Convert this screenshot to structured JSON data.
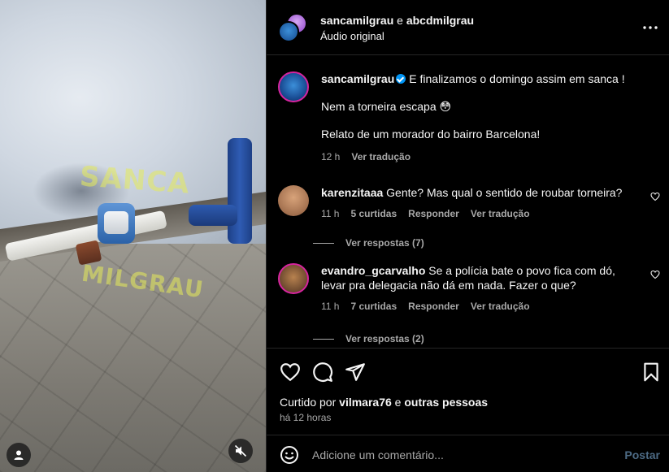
{
  "media": {
    "watermark_top": "SANCA",
    "watermark_bottom": "MILGRAU"
  },
  "header": {
    "user1": "sancamilgrau",
    "conj": "e",
    "user2": "abcdmilgrau",
    "audio": "Áudio original"
  },
  "caption": {
    "username": "sancamilgrau",
    "line1": "E finalizamos o domingo assim em sanca !",
    "line2": "Nem a torneira escapa 😳",
    "line3": "Relato de um morador do bairro Barcelona!",
    "time": "12 h",
    "translate": "Ver tradução"
  },
  "comments": [
    {
      "username": "karenzitaaa",
      "text": "Gente? Mas qual o sentido de roubar torneira?",
      "time": "11 h",
      "likes": "5 curtidas",
      "reply": "Responder",
      "translate": "Ver tradução",
      "replies": "Ver respostas (7)"
    },
    {
      "username": "evandro_gcarvalho",
      "text": "Se a polícia bate o povo fica com dó, levar pra delegacia não dá em nada. Fazer o que?",
      "time": "11 h",
      "likes": "7 curtidas",
      "reply": "Responder",
      "translate": "Ver tradução",
      "replies": "Ver respostas (2)"
    }
  ],
  "actions": {
    "liked_prefix": "Curtido por",
    "liked_user": "vilmara76",
    "liked_conj": "e",
    "liked_others": "outras pessoas",
    "time_ago": "há 12 horas"
  },
  "composer": {
    "placeholder": "Adicione um comentário...",
    "post": "Postar"
  },
  "colors": {
    "accent": "#0095f6",
    "muted": "#a8a8a8",
    "post_disabled": "#4d6b85"
  }
}
